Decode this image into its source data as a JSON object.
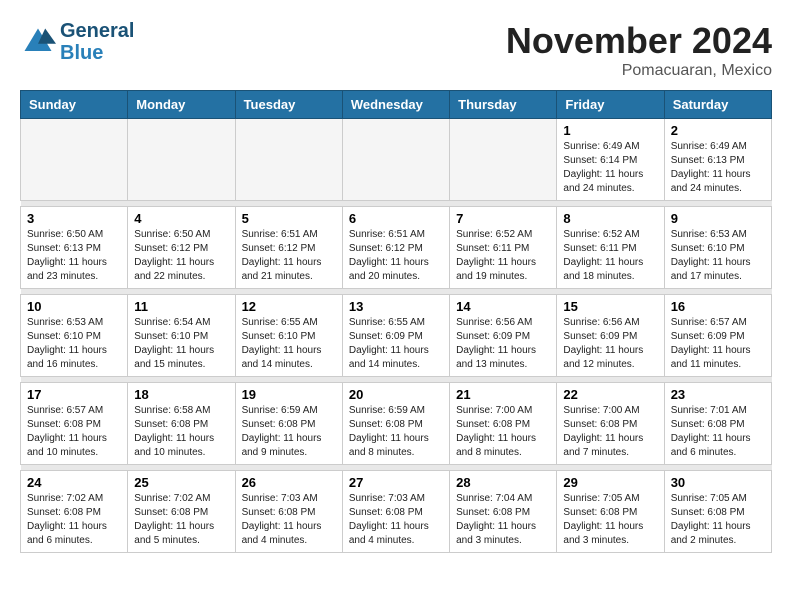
{
  "logo": {
    "line1": "General",
    "line2": "Blue"
  },
  "header": {
    "month": "November 2024",
    "location": "Pomacuaran, Mexico"
  },
  "weekdays": [
    "Sunday",
    "Monday",
    "Tuesday",
    "Wednesday",
    "Thursday",
    "Friday",
    "Saturday"
  ],
  "weeks": [
    [
      {
        "day": "",
        "empty": true
      },
      {
        "day": "",
        "empty": true
      },
      {
        "day": "",
        "empty": true
      },
      {
        "day": "",
        "empty": true
      },
      {
        "day": "",
        "empty": true
      },
      {
        "day": "1",
        "sunrise": "6:49 AM",
        "sunset": "6:14 PM",
        "daylight": "11 hours and 24 minutes."
      },
      {
        "day": "2",
        "sunrise": "6:49 AM",
        "sunset": "6:13 PM",
        "daylight": "11 hours and 24 minutes."
      }
    ],
    [
      {
        "day": "3",
        "sunrise": "6:50 AM",
        "sunset": "6:13 PM",
        "daylight": "11 hours and 23 minutes."
      },
      {
        "day": "4",
        "sunrise": "6:50 AM",
        "sunset": "6:12 PM",
        "daylight": "11 hours and 22 minutes."
      },
      {
        "day": "5",
        "sunrise": "6:51 AM",
        "sunset": "6:12 PM",
        "daylight": "11 hours and 21 minutes."
      },
      {
        "day": "6",
        "sunrise": "6:51 AM",
        "sunset": "6:12 PM",
        "daylight": "11 hours and 20 minutes."
      },
      {
        "day": "7",
        "sunrise": "6:52 AM",
        "sunset": "6:11 PM",
        "daylight": "11 hours and 19 minutes."
      },
      {
        "day": "8",
        "sunrise": "6:52 AM",
        "sunset": "6:11 PM",
        "daylight": "11 hours and 18 minutes."
      },
      {
        "day": "9",
        "sunrise": "6:53 AM",
        "sunset": "6:10 PM",
        "daylight": "11 hours and 17 minutes."
      }
    ],
    [
      {
        "day": "10",
        "sunrise": "6:53 AM",
        "sunset": "6:10 PM",
        "daylight": "11 hours and 16 minutes."
      },
      {
        "day": "11",
        "sunrise": "6:54 AM",
        "sunset": "6:10 PM",
        "daylight": "11 hours and 15 minutes."
      },
      {
        "day": "12",
        "sunrise": "6:55 AM",
        "sunset": "6:10 PM",
        "daylight": "11 hours and 14 minutes."
      },
      {
        "day": "13",
        "sunrise": "6:55 AM",
        "sunset": "6:09 PM",
        "daylight": "11 hours and 14 minutes."
      },
      {
        "day": "14",
        "sunrise": "6:56 AM",
        "sunset": "6:09 PM",
        "daylight": "11 hours and 13 minutes."
      },
      {
        "day": "15",
        "sunrise": "6:56 AM",
        "sunset": "6:09 PM",
        "daylight": "11 hours and 12 minutes."
      },
      {
        "day": "16",
        "sunrise": "6:57 AM",
        "sunset": "6:09 PM",
        "daylight": "11 hours and 11 minutes."
      }
    ],
    [
      {
        "day": "17",
        "sunrise": "6:57 AM",
        "sunset": "6:08 PM",
        "daylight": "11 hours and 10 minutes."
      },
      {
        "day": "18",
        "sunrise": "6:58 AM",
        "sunset": "6:08 PM",
        "daylight": "11 hours and 10 minutes."
      },
      {
        "day": "19",
        "sunrise": "6:59 AM",
        "sunset": "6:08 PM",
        "daylight": "11 hours and 9 minutes."
      },
      {
        "day": "20",
        "sunrise": "6:59 AM",
        "sunset": "6:08 PM",
        "daylight": "11 hours and 8 minutes."
      },
      {
        "day": "21",
        "sunrise": "7:00 AM",
        "sunset": "6:08 PM",
        "daylight": "11 hours and 8 minutes."
      },
      {
        "day": "22",
        "sunrise": "7:00 AM",
        "sunset": "6:08 PM",
        "daylight": "11 hours and 7 minutes."
      },
      {
        "day": "23",
        "sunrise": "7:01 AM",
        "sunset": "6:08 PM",
        "daylight": "11 hours and 6 minutes."
      }
    ],
    [
      {
        "day": "24",
        "sunrise": "7:02 AM",
        "sunset": "6:08 PM",
        "daylight": "11 hours and 6 minutes."
      },
      {
        "day": "25",
        "sunrise": "7:02 AM",
        "sunset": "6:08 PM",
        "daylight": "11 hours and 5 minutes."
      },
      {
        "day": "26",
        "sunrise": "7:03 AM",
        "sunset": "6:08 PM",
        "daylight": "11 hours and 4 minutes."
      },
      {
        "day": "27",
        "sunrise": "7:03 AM",
        "sunset": "6:08 PM",
        "daylight": "11 hours and 4 minutes."
      },
      {
        "day": "28",
        "sunrise": "7:04 AM",
        "sunset": "6:08 PM",
        "daylight": "11 hours and 3 minutes."
      },
      {
        "day": "29",
        "sunrise": "7:05 AM",
        "sunset": "6:08 PM",
        "daylight": "11 hours and 3 minutes."
      },
      {
        "day": "30",
        "sunrise": "7:05 AM",
        "sunset": "6:08 PM",
        "daylight": "11 hours and 2 minutes."
      }
    ]
  ]
}
